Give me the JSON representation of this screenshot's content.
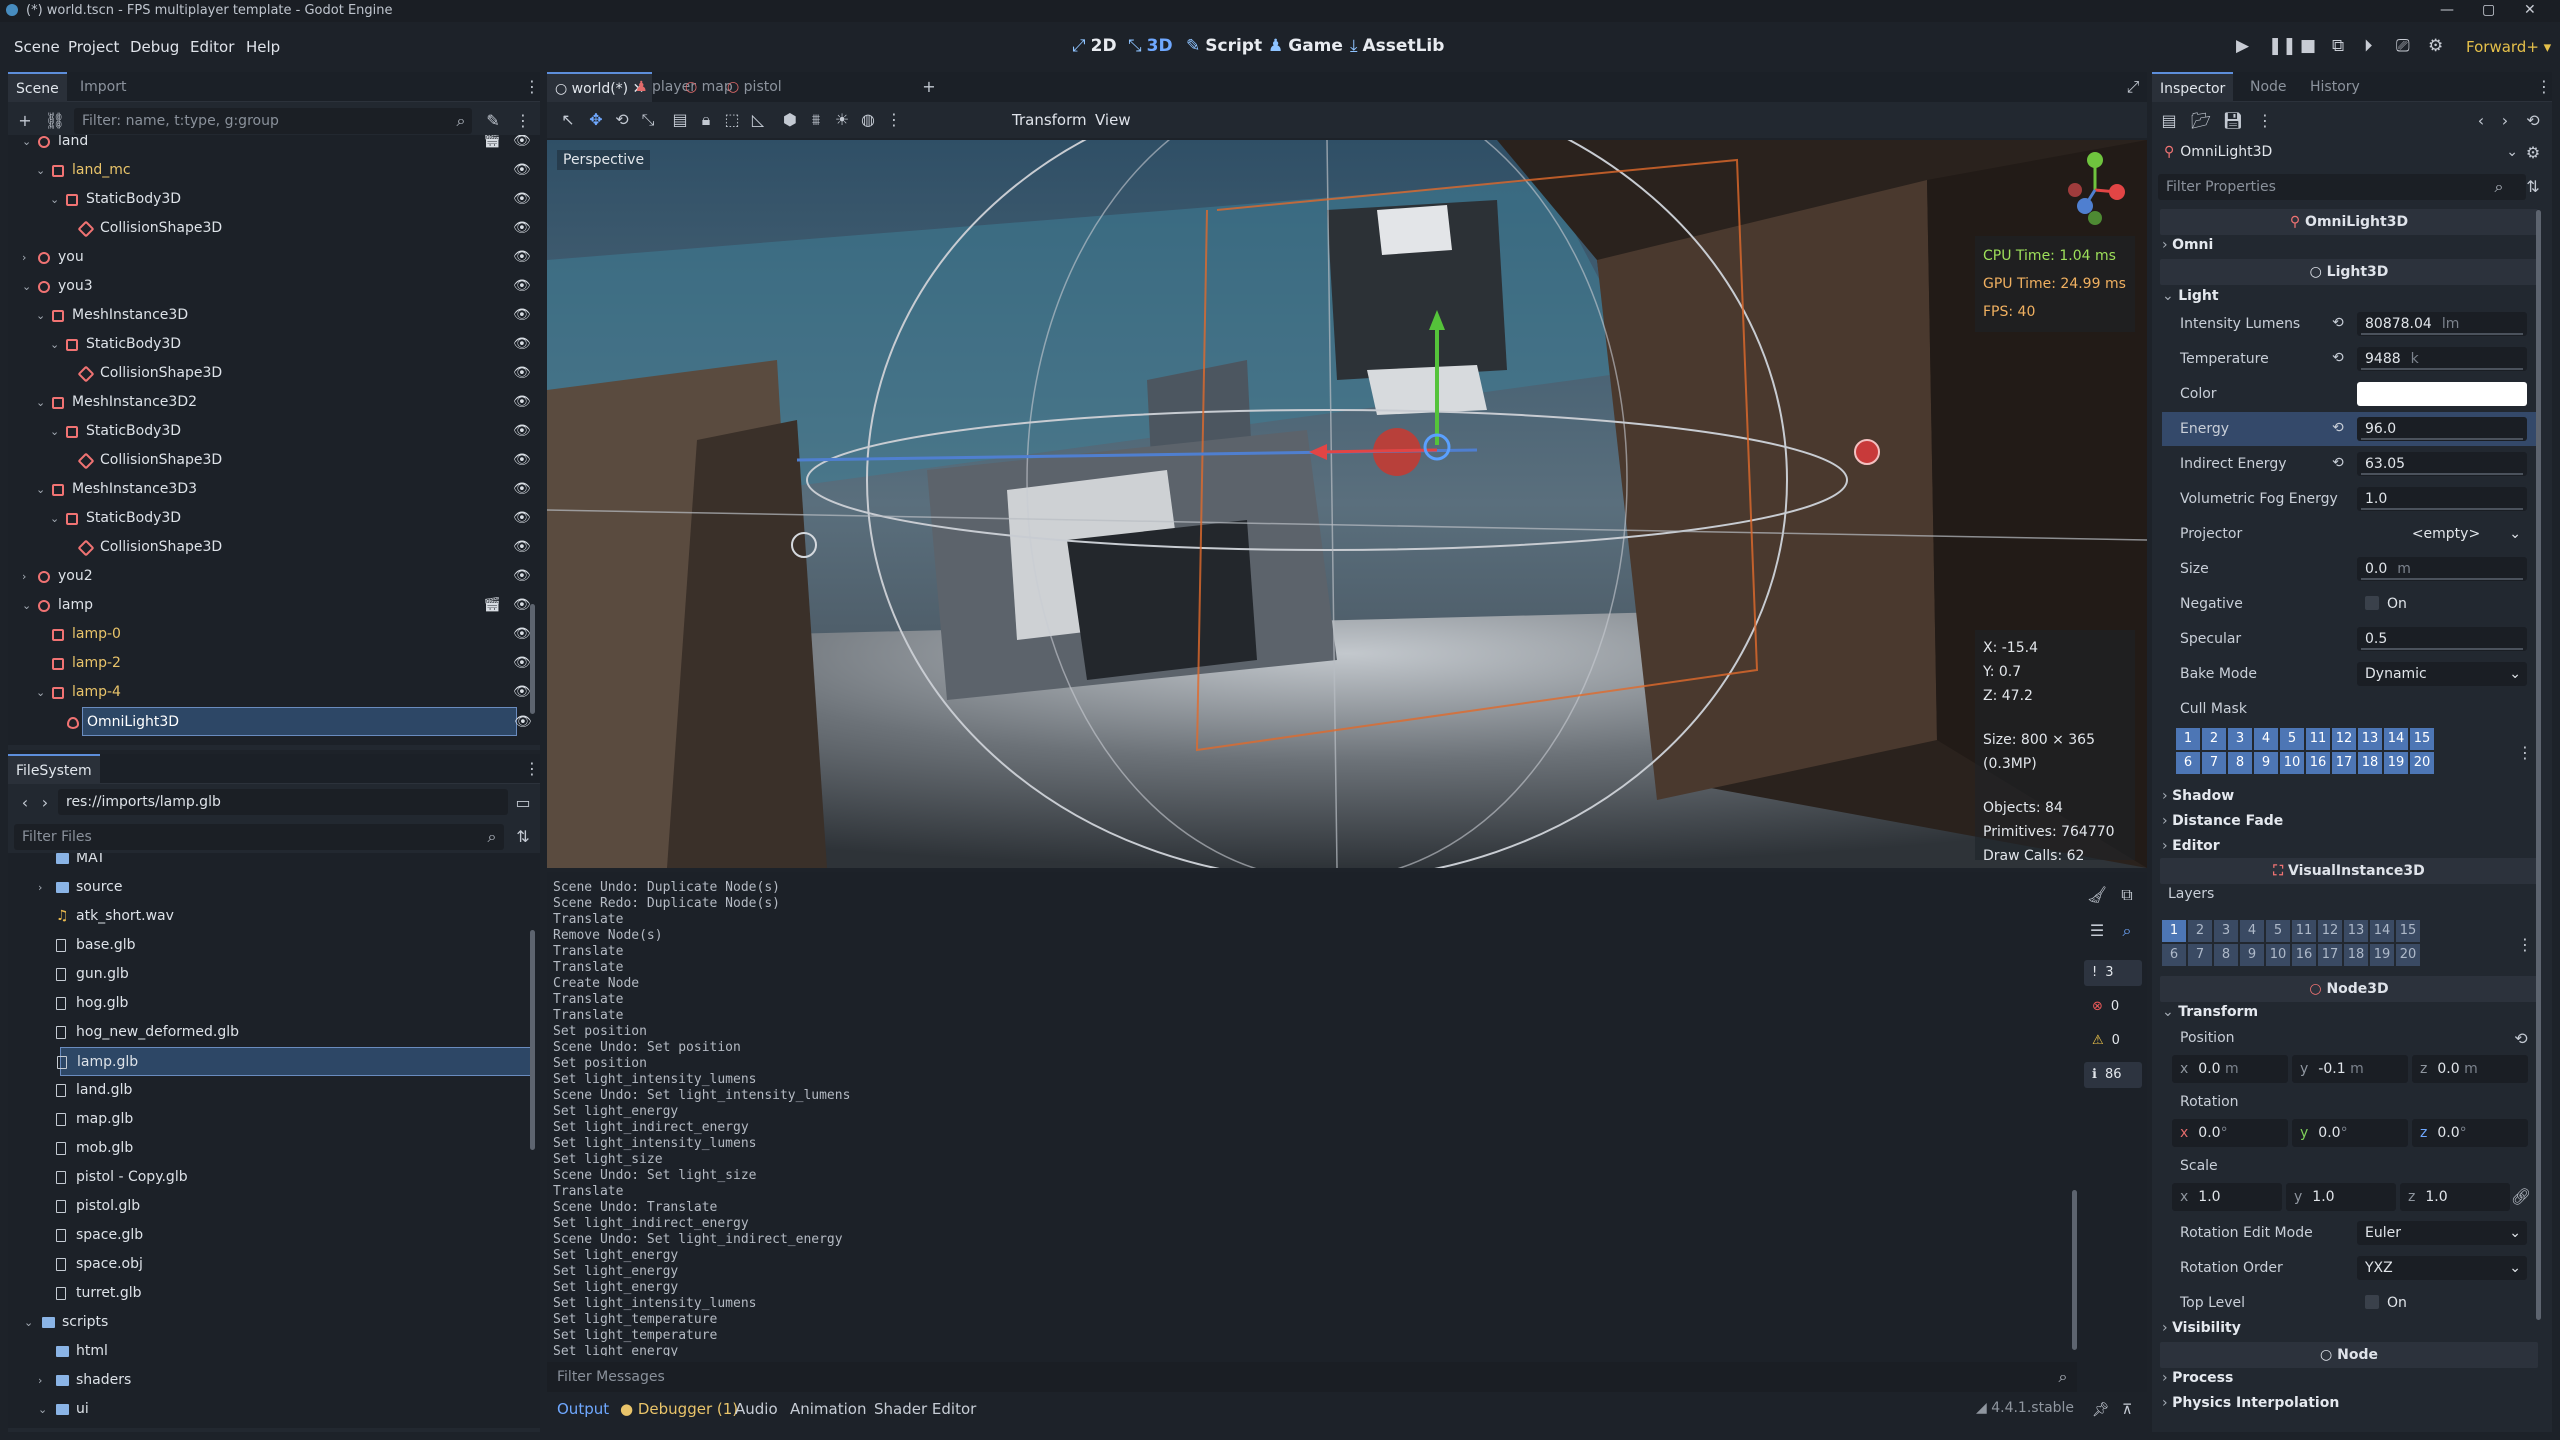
{
  "window": {
    "title": "(*) world.tscn - FPS multiplayer template - Godot Engine",
    "controls": [
      "—",
      "▢",
      "✕"
    ]
  },
  "menu": [
    "Scene",
    "Project",
    "Debug",
    "Editor",
    "Help"
  ],
  "workspaces": [
    {
      "label": "2D",
      "glyph": "⤢"
    },
    {
      "label": "3D",
      "glyph": "⤡"
    },
    {
      "label": "Script",
      "glyph": "✎"
    },
    {
      "label": "Game",
      "glyph": "♟"
    },
    {
      "label": "AssetLib",
      "glyph": "⤓"
    }
  ],
  "renderer": "Forward+",
  "scene_dock": {
    "tabs": [
      "Scene",
      "Import"
    ],
    "filter_placeholder": "Filter: name, t:type, g:group",
    "tree": [
      {
        "label": "land",
        "depth": 0,
        "icon": "node3d",
        "expanded": true,
        "color": "#dde2e8",
        "extra": true
      },
      {
        "label": "land_mc",
        "depth": 1,
        "icon": "mesh",
        "expanded": true,
        "color": "#e9c46a"
      },
      {
        "label": "StaticBody3D",
        "depth": 2,
        "icon": "body",
        "expanded": true,
        "color": "#dde2e8"
      },
      {
        "label": "CollisionShape3D",
        "depth": 3,
        "icon": "coll",
        "color": "#dde2e8"
      },
      {
        "label": "you",
        "depth": 0,
        "icon": "node3d",
        "expanded": false,
        "color": "#dde2e8"
      },
      {
        "label": "you3",
        "depth": 0,
        "icon": "node3d",
        "expanded": true,
        "color": "#dde2e8"
      },
      {
        "label": "MeshInstance3D",
        "depth": 1,
        "icon": "mesh",
        "expanded": true,
        "color": "#dde2e8"
      },
      {
        "label": "StaticBody3D",
        "depth": 2,
        "icon": "body",
        "expanded": true,
        "color": "#dde2e8"
      },
      {
        "label": "CollisionShape3D",
        "depth": 3,
        "icon": "coll",
        "color": "#dde2e8"
      },
      {
        "label": "MeshInstance3D2",
        "depth": 1,
        "icon": "mesh",
        "expanded": true,
        "color": "#dde2e8"
      },
      {
        "label": "StaticBody3D",
        "depth": 2,
        "icon": "body",
        "expanded": true,
        "color": "#dde2e8"
      },
      {
        "label": "CollisionShape3D",
        "depth": 3,
        "icon": "coll",
        "color": "#dde2e8"
      },
      {
        "label": "MeshInstance3D3",
        "depth": 1,
        "icon": "mesh",
        "expanded": true,
        "color": "#dde2e8"
      },
      {
        "label": "StaticBody3D",
        "depth": 2,
        "icon": "body",
        "expanded": true,
        "color": "#dde2e8"
      },
      {
        "label": "CollisionShape3D",
        "depth": 3,
        "icon": "coll",
        "color": "#dde2e8"
      },
      {
        "label": "you2",
        "depth": 0,
        "icon": "node3d",
        "expanded": false,
        "color": "#dde2e8"
      },
      {
        "label": "lamp",
        "depth": 0,
        "icon": "node3d",
        "expanded": true,
        "color": "#dde2e8",
        "extra": true
      },
      {
        "label": "lamp-0",
        "depth": 1,
        "icon": "mesh",
        "color": "#e9c46a"
      },
      {
        "label": "lamp-2",
        "depth": 1,
        "icon": "mesh",
        "color": "#e9c46a"
      },
      {
        "label": "lamp-4",
        "depth": 1,
        "icon": "mesh",
        "expanded": true,
        "color": "#e9c46a"
      },
      {
        "label": "OmniLight3D",
        "depth": 2,
        "icon": "light",
        "color": "#ffffff",
        "selected": true
      }
    ]
  },
  "filesystem": {
    "tab": "FileSystem",
    "path": "res://imports/lamp.glb",
    "filter_placeholder": "Filter Files",
    "items": [
      {
        "label": "MAT",
        "depth": 1,
        "type": "folder"
      },
      {
        "label": "source",
        "depth": 1,
        "type": "folder",
        "collapsed": true
      },
      {
        "label": "atk_short.wav",
        "depth": 1,
        "type": "audio"
      },
      {
        "label": "base.glb",
        "depth": 1,
        "type": "file"
      },
      {
        "label": "gun.glb",
        "depth": 1,
        "type": "file"
      },
      {
        "label": "hog.glb",
        "depth": 1,
        "type": "file"
      },
      {
        "label": "hog_new_deformed.glb",
        "depth": 1,
        "type": "file"
      },
      {
        "label": "lamp.glb",
        "depth": 1,
        "type": "file",
        "selected": true
      },
      {
        "label": "land.glb",
        "depth": 1,
        "type": "file"
      },
      {
        "label": "map.glb",
        "depth": 1,
        "type": "file"
      },
      {
        "label": "mob.glb",
        "depth": 1,
        "type": "file"
      },
      {
        "label": "pistol - Copy.glb",
        "depth": 1,
        "type": "file"
      },
      {
        "label": "pistol.glb",
        "depth": 1,
        "type": "file"
      },
      {
        "label": "space.glb",
        "depth": 1,
        "type": "file"
      },
      {
        "label": "space.obj",
        "depth": 1,
        "type": "file"
      },
      {
        "label": "turret.glb",
        "depth": 1,
        "type": "file"
      },
      {
        "label": "scripts",
        "depth": 0,
        "type": "folder",
        "expanded": true
      },
      {
        "label": "html",
        "depth": 1,
        "type": "folder"
      },
      {
        "label": "shaders",
        "depth": 1,
        "type": "folder",
        "collapsed": true
      },
      {
        "label": "ui",
        "depth": 1,
        "type": "folder",
        "expanded": true
      }
    ]
  },
  "editor_tabs": [
    {
      "label": "world(*)",
      "active": true
    },
    {
      "label": "player"
    },
    {
      "label": "map"
    },
    {
      "label": "pistol"
    }
  ],
  "viewport_toolbar": {
    "transform": "Transform",
    "view": "View"
  },
  "viewport": {
    "mode_label": "Perspective",
    "stats": {
      "cpu": "CPU Time: 1.04 ms",
      "gpu": "GPU Time: 24.99 ms",
      "fps": "FPS: 40"
    },
    "info": {
      "x": "X: -15.4",
      "y": "Y: 0.7",
      "z": "Z: 47.2",
      "size": "Size: 800 × 365 (0.3MP)",
      "objects": "Objects: 84",
      "primitives": "Primitives: 764770",
      "drawcalls": "Draw Calls: 62"
    }
  },
  "output": {
    "lines": [
      "Scene Undo: Duplicate Node(s)",
      "Scene Redo: Duplicate Node(s)",
      "Translate",
      "Remove Node(s)",
      "Translate",
      "Translate",
      "Create Node",
      "Translate",
      "Translate",
      "Set position",
      "Scene Undo: Set position",
      "Set position",
      "Set light_intensity_lumens",
      "Scene Undo: Set light_intensity_lumens",
      "Set light_energy",
      "Set light_indirect_energy",
      "Set light_intensity_lumens",
      "Set light_size",
      "Scene Undo: Set light_size",
      "Translate",
      "Scene Undo: Translate",
      "Set light_indirect_energy",
      "Scene Undo: Set light_indirect_energy",
      "Set light_energy",
      "Set light_energy",
      "Set light_energy",
      "Set light_intensity_lumens",
      "Set light_temperature",
      "Set light_temperature",
      "Set light_energy"
    ],
    "filter_placeholder": "Filter Messages",
    "counters": {
      "logs": "3",
      "errors": "0",
      "warnings": "0",
      "info": "86"
    }
  },
  "bottom_tabs": [
    "Output",
    "Debugger (1)",
    "Audio",
    "Animation",
    "Shader Editor"
  ],
  "version": "4.4.1.stable",
  "inspector": {
    "tabs": [
      "Inspector",
      "Node",
      "History"
    ],
    "node_name": "OmniLight3D",
    "filter_placeholder": "Filter Properties",
    "class_omni": "OmniLight3D",
    "sect_omni": "Omni",
    "class_light": "Light3D",
    "sect_light": "Light",
    "props_light": [
      {
        "name": "Intensity Lumens",
        "value": "80878.04",
        "unit": "lm",
        "reset": true
      },
      {
        "name": "Temperature",
        "value": "9488",
        "unit": "k",
        "reset": true
      },
      {
        "name": "Color",
        "value": "",
        "type": "color"
      },
      {
        "name": "Energy",
        "value": "96.0",
        "reset": true,
        "highlight": true
      },
      {
        "name": "Indirect Energy",
        "value": "63.05",
        "reset": true
      },
      {
        "name": "Volumetric Fog Energy",
        "value": "1.0"
      },
      {
        "name": "Projector",
        "value": "<empty>",
        "type": "dropdown"
      },
      {
        "name": "Size",
        "value": "0.0",
        "unit": "m"
      },
      {
        "name": "Negative",
        "value": "On",
        "type": "check"
      },
      {
        "name": "Specular",
        "value": "0.5"
      },
      {
        "name": "Bake Mode",
        "value": "Dynamic",
        "type": "dropdown"
      },
      {
        "name": "Cull Mask",
        "value": "",
        "type": "label"
      }
    ],
    "cull_mask": [
      "1",
      "2",
      "3",
      "4",
      "5",
      "11",
      "12",
      "13",
      "14",
      "15",
      "6",
      "7",
      "8",
      "9",
      "10",
      "16",
      "17",
      "18",
      "19",
      "20"
    ],
    "sect_shadow": "Shadow",
    "sect_distance": "Distance Fade",
    "sect_editor": "Editor",
    "class_visual": "VisualInstance3D",
    "layers_label": "Layers",
    "layers": [
      "1",
      "2",
      "3",
      "4",
      "5",
      "11",
      "12",
      "13",
      "14",
      "15",
      "6",
      "7",
      "8",
      "9",
      "10",
      "16",
      "17",
      "18",
      "19",
      "20"
    ],
    "class_node3d": "Node3D",
    "sect_transform": "Transform",
    "position_label": "Position",
    "position": {
      "x": "0.0",
      "y": "-0.1",
      "z": "0.0",
      "unit": "m"
    },
    "rotation_label": "Rotation",
    "rotation": {
      "x": "0.0",
      "y": "0.0",
      "z": "0.0",
      "unit": "°"
    },
    "scale_label": "Scale",
    "scale": {
      "x": "1.0",
      "y": "1.0",
      "z": "1.0"
    },
    "props_transform": [
      {
        "name": "Rotation Edit Mode",
        "value": "Euler",
        "type": "dropdown"
      },
      {
        "name": "Rotation Order",
        "value": "YXZ",
        "type": "dropdown"
      },
      {
        "name": "Top Level",
        "value": "On",
        "type": "check"
      }
    ],
    "sect_visibility": "Visibility",
    "class_node": "Node",
    "sect_process": "Process",
    "sect_physics": "Physics Interpolation"
  }
}
